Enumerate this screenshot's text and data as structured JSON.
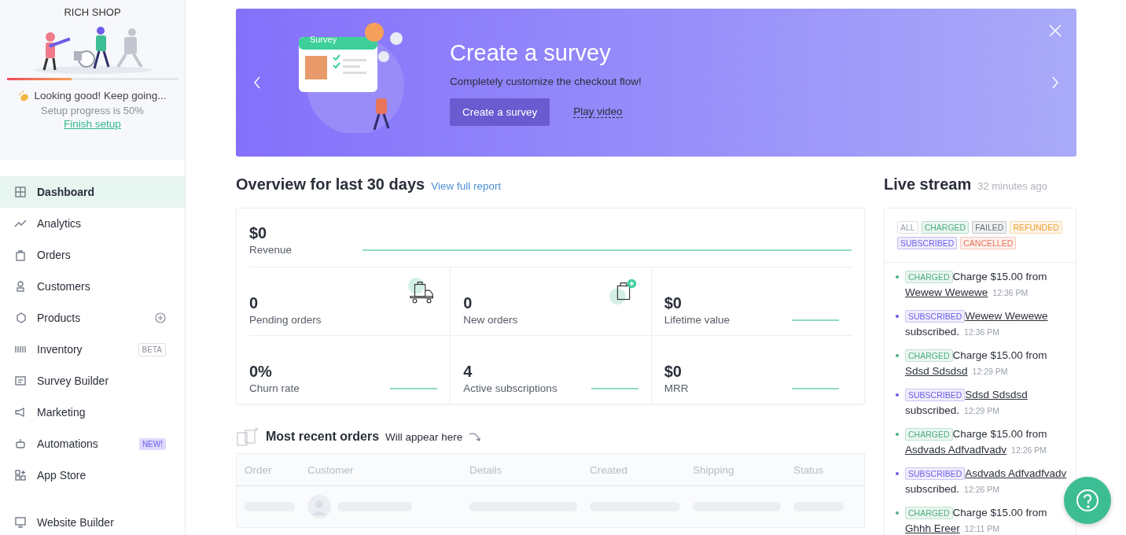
{
  "sidebar": {
    "shop_name": "RICH SHOP",
    "setup": {
      "level": 0.38,
      "message": "Looking good! Keep going...",
      "progress_text": "Setup progress is 50%",
      "link": "Finish setup"
    },
    "nav": [
      {
        "label": "Dashboard",
        "selected": true
      },
      {
        "label": "Analytics",
        "selected": false
      },
      {
        "label": "Orders",
        "selected": false
      },
      {
        "label": "Customers",
        "selected": false
      },
      {
        "label": "Products",
        "selected": false,
        "kind": "add"
      },
      {
        "label": "Inventory",
        "selected": false,
        "kind": "beta",
        "badge": "BETA"
      },
      {
        "label": "Survey Builder",
        "selected": false
      },
      {
        "label": "Marketing",
        "selected": false
      },
      {
        "label": "Automations",
        "selected": false,
        "kind": "new",
        "badge": "NEW!"
      },
      {
        "label": "App Store",
        "selected": false
      },
      {
        "label": "Website Builder",
        "selected": false,
        "kind": "separated"
      }
    ]
  },
  "banner": {
    "card_title": "Survey",
    "title": "Create a survey",
    "subtitle": "Completely customize the checkout flow!",
    "button": "Create a survey",
    "link": "Play video"
  },
  "overview": {
    "title": "Overview for last 30 days",
    "link": "View full report",
    "revenue": {
      "value": "$0",
      "label": "Revenue"
    },
    "stats": [
      {
        "value": "0",
        "label": "Pending orders",
        "kind": "truck"
      },
      {
        "value": "0",
        "label": "New orders",
        "kind": "bag"
      },
      {
        "value": "$0",
        "label": "Lifetime value",
        "kind": "trend"
      },
      {
        "value": "0%",
        "label": "Churn rate",
        "kind": "trend"
      },
      {
        "value": "4",
        "label": "Active subscriptions",
        "kind": "trend"
      },
      {
        "value": "$0",
        "label": "MRR",
        "kind": "trend"
      }
    ]
  },
  "orders": {
    "title": "Most recent orders",
    "hint": "Will appear here",
    "columns": [
      "Order",
      "Customer",
      "Details",
      "Created",
      "Shipping",
      "Status"
    ]
  },
  "stream": {
    "title": "Live stream",
    "updated": "32 minutes ago",
    "filters": [
      {
        "label": "ALL",
        "color": "#9aa0ab"
      },
      {
        "label": "CHARGED",
        "color": "#4caf7d"
      },
      {
        "label": "FAILED",
        "color": "#6b7280"
      },
      {
        "label": "REFUNDED",
        "color": "#f0a030"
      },
      {
        "label": "SUBSCRIBED",
        "color": "#6c5ce7"
      },
      {
        "label": "CANCELLED",
        "color": "#e8745a"
      }
    ],
    "events": [
      {
        "kind": "charged",
        "tag": "CHARGED",
        "color": "#4caf7d",
        "text": "Charge $15.00 from",
        "name": "Wewew Wewewe",
        "time": "12:36 PM"
      },
      {
        "kind": "subscribed",
        "tag": "SUBSCRIBED",
        "color": "#6c5ce7",
        "name": "Wewew Wewewe",
        "text": "subscribed.",
        "time": "12:36 PM"
      },
      {
        "kind": "charged",
        "tag": "CHARGED",
        "color": "#4caf7d",
        "text": "Charge $15.00 from",
        "name": "Sdsd Sdsdsd",
        "time": "12:29 PM"
      },
      {
        "kind": "subscribed",
        "tag": "SUBSCRIBED",
        "color": "#6c5ce7",
        "name": "Sdsd Sdsdsd",
        "text": "subscribed.",
        "time": "12:29 PM"
      },
      {
        "kind": "charged",
        "tag": "CHARGED",
        "color": "#4caf7d",
        "text": "Charge $15.00 from",
        "name": "Asdvads Adfvadfvadv",
        "time": "12:26 PM"
      },
      {
        "kind": "subscribed",
        "tag": "SUBSCRIBED",
        "color": "#6c5ce7",
        "name": "Asdvads Adfvadfvadv",
        "text": "subscribed.",
        "time": "12:26 PM"
      },
      {
        "kind": "charged",
        "tag": "CHARGED",
        "color": "#4caf7d",
        "text": "Charge $15.00 from",
        "name": "Ghhh Ereer",
        "time": "12:11 PM"
      }
    ]
  }
}
